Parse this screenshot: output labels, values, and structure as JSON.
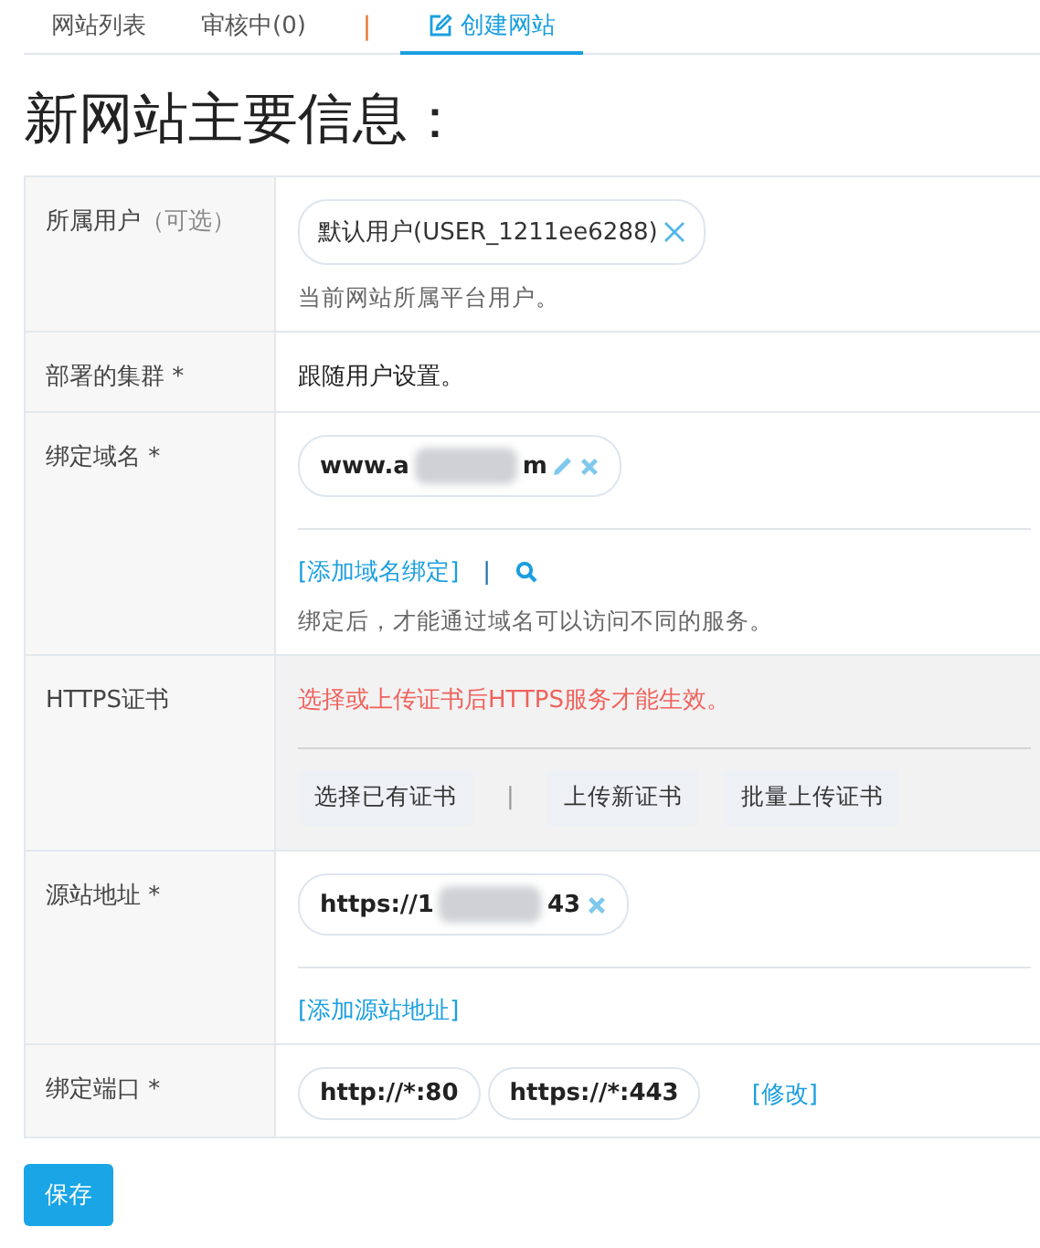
{
  "tabs": [
    {
      "kind": "tab",
      "label": "网站列表",
      "selected": false,
      "icon": false
    },
    {
      "kind": "tab",
      "label": "审核中(0)",
      "selected": false,
      "icon": false
    },
    {
      "kind": "separator",
      "label": "|"
    },
    {
      "kind": "tab",
      "label": "创建网站",
      "selected": true,
      "icon": true
    }
  ],
  "title": "新网站主要信息：",
  "rows": [
    {
      "kind": "user",
      "label": "所属用户",
      "optional": "（可选）",
      "tag": "默认用户(USER_1211ee6288)",
      "help": "当前网站所属平台用户。"
    },
    {
      "kind": "text",
      "label": "部署的集群 *",
      "value": "跟随用户设置。"
    },
    {
      "kind": "list",
      "label": "绑定域名 *",
      "tags": [
        {
          "start": "www.a",
          "end": "m",
          "redacted": true,
          "editable": true
        }
      ],
      "add_link": "[添加域名绑定]",
      "divider": "|",
      "search": true,
      "help": "绑定后，才能通过域名可以访问不同的服务。"
    },
    {
      "kind": "https",
      "label": "HTTPS证书",
      "warning": "选择或上传证书后HTTPS服务才能生效。",
      "buttons": [
        {
          "kind": "button",
          "label": "选择已有证书"
        },
        {
          "kind": "separator",
          "label": "|"
        },
        {
          "kind": "button",
          "label": "上传新证书"
        },
        {
          "kind": "button",
          "label": "批量上传证书"
        }
      ]
    },
    {
      "kind": "list",
      "label": "源站地址 *",
      "tags": [
        {
          "start": "https://1",
          "end": "43",
          "redacted": true,
          "editable": false
        }
      ],
      "add_link": "[添加源站地址]"
    },
    {
      "kind": "ports",
      "label": "绑定端口 *",
      "tags": [
        "http://*:80",
        "https://*:443"
      ],
      "link": "[修改]"
    }
  ],
  "save": "保存"
}
